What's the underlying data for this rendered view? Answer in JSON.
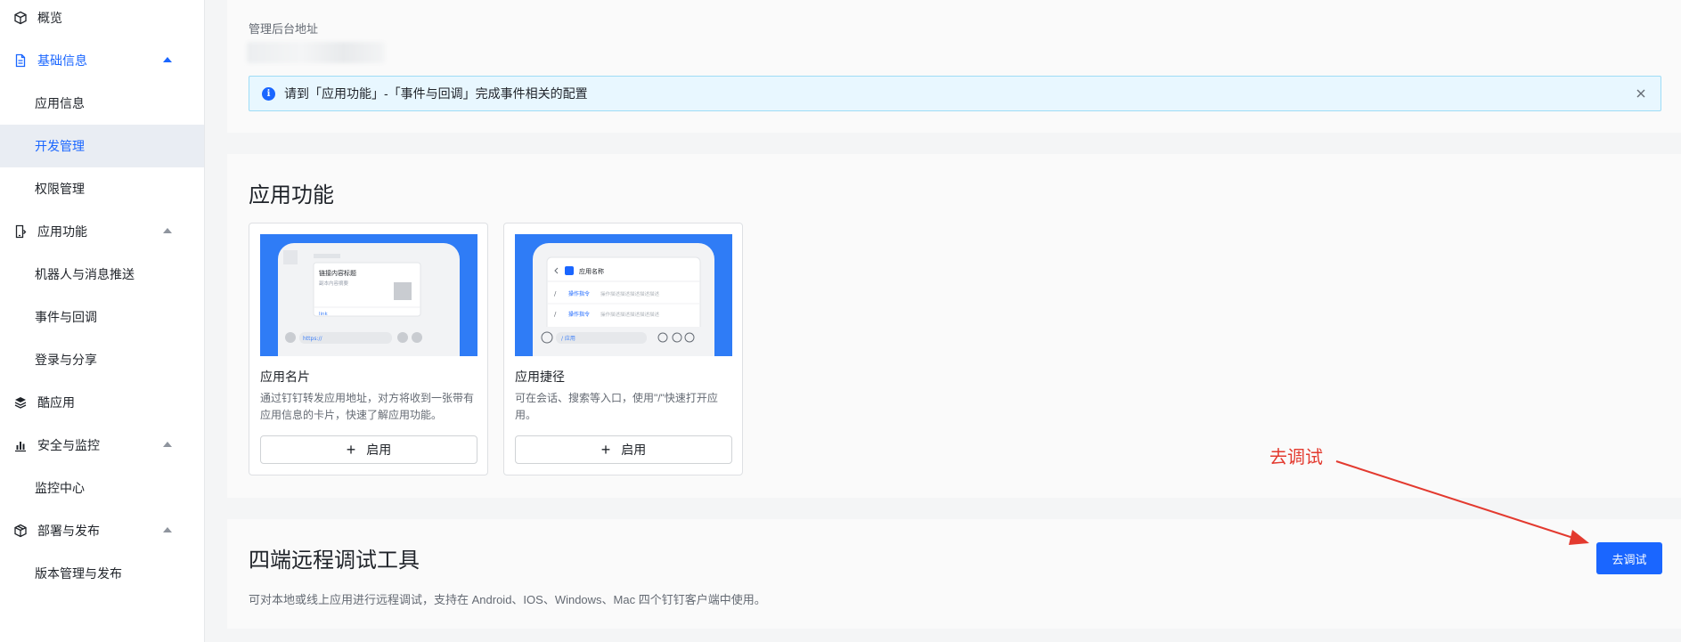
{
  "sidebar": {
    "overview": "概览",
    "basic_info": "基础信息",
    "app_info": "应用信息",
    "dev_manage": "开发管理",
    "permission_manage": "权限管理",
    "app_features": "应用功能",
    "robot_push": "机器人与消息推送",
    "event_callback": "事件与回调",
    "login_share": "登录与分享",
    "cool_app": "酷应用",
    "security_monitor": "安全与监控",
    "monitor_center": "监控中心",
    "deploy_publish": "部署与发布",
    "version_publish": "版本管理与发布"
  },
  "top": {
    "url_label": "管理后台地址",
    "alert_text": "请到「应用功能」-「事件与回调」完成事件相关的配置"
  },
  "features": {
    "title": "应用功能",
    "cards": [
      {
        "name": "应用名片",
        "desc": "通过钉钉转发应用地址，对方将收到一张带有应用信息的卡片，快速了解应用功能。",
        "button": "启用",
        "preview": {
          "card_title": "链接内容标题",
          "card_sub": "副本内容摘要",
          "link": "link",
          "input": "https://"
        }
      },
      {
        "name": "应用捷径",
        "desc": "可在会话、搜索等入口，使用\"/\"快速打开应用。",
        "button": "启用",
        "preview": {
          "app_name": "应用名称",
          "cmd": "操作指令",
          "cmd_desc": "操作描述描述描述描述描述",
          "input": "/ 应用"
        }
      }
    ]
  },
  "debug": {
    "title": "四端远程调试工具",
    "desc": "可对本地或线上应用进行远程调试，支持在 Android、IOS、Windows、Mac 四个钉钉客户端中使用。",
    "button": "去调试",
    "annotation": "去调试"
  },
  "colors": {
    "accent": "#1a66ff",
    "annotation": "#e33a2f"
  }
}
